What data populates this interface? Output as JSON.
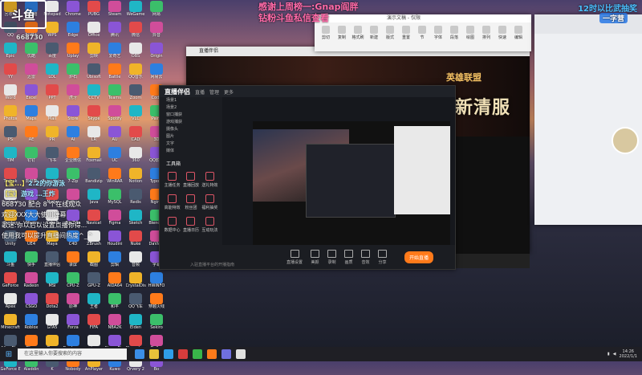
{
  "overlay": {
    "logo": "斗鱼",
    "room_id": "668730",
    "thanks": [
      "感谢上周榜一:Gnap阎胖",
      "钻粉斗鱼私信查看"
    ],
    "danmaku": [
      {
        "user": "【宝...】",
        "text": "2.2的你游泳"
      },
      {
        "user": "【宝】",
        "text": "游戏 …王炸"
      },
      {
        "user": "",
        "text": "668730 配合 8 个在线观众"
      },
      {
        "user": "",
        "text": "欢迎XXX大大使用弹幕"
      },
      {
        "user": "",
        "text": "歌迷:你以后以设置点播你得..."
      },
      {
        "user": "",
        "text": "使用我可以提升直播间热度^_^"
      }
    ]
  },
  "desktop_icons": [
    "回收站",
    "此电脑",
    "Notepad",
    "Chrome",
    "PUBG",
    "Steam",
    "WeGame",
    "网易",
    "QQ",
    "BiliBili",
    "WPS",
    "Edge",
    "Office",
    "腾讯",
    "微信",
    "抖音",
    "Epic",
    "优酷",
    "百度",
    "Uplay",
    "剪映",
    "爱奇艺",
    "OBS",
    "Origin",
    "YY",
    "迅雷",
    "LOL",
    "炉石",
    "Ubisoft",
    "Battle",
    "QQ音乐",
    "网易云",
    "Word",
    "Excel",
    "PPT",
    "虎牙",
    "CCTV",
    "Teams",
    "Zoom",
    "Code",
    "Photos",
    "Maps",
    "Mail",
    "Store",
    "Skype",
    "Spotify",
    "VLC",
    "Paint",
    "PS",
    "AE",
    "PR",
    "AI",
    "LR",
    "AU",
    "CAD",
    "3D",
    "TIM",
    "钉钉",
    "飞书",
    "企业微信",
    "Foxmail",
    "UC",
    "360",
    "QQ影音",
    "Todesk",
    "向日葵",
    "Everything",
    "7-Zip",
    "Bandizip",
    "WinRAR",
    "Notion",
    "Typora",
    "Postman",
    "Git",
    "Node",
    "Python",
    "Java",
    "MySQL",
    "Redis",
    "Nginx",
    "Docker",
    "VMware",
    "Xshell",
    "FileZilla",
    "Navicat",
    "Figma",
    "Sketch",
    "Blender",
    "Unity",
    "UE4",
    "Maya",
    "C4D",
    "ZBrush",
    "Houdini",
    "Nuke",
    "DaVinci",
    "斗鱼",
    "快手",
    "直播伴侣",
    "录屏",
    "截图",
    "剪辑",
    "音频",
    "字幕",
    "GeForce",
    "Radeon",
    "MSI",
    "CPU-Z",
    "GPU-Z",
    "AIDA64",
    "CrystalDisk",
    "HWiNFO",
    "Apex",
    "CSGO",
    "Dota2",
    "原神",
    "王者",
    "和平",
    "QQ飞车",
    "穿越火线",
    "Minecraft",
    "Roblox",
    "GTA5",
    "Forza",
    "FIFA",
    "NBA2K",
    "Elden",
    "Sekiro",
    "Alisa Play",
    "Dhog",
    "Gogo",
    "Dual game",
    "autorun",
    "SteamPics",
    "Chuanlong",
    "Dollar",
    "GeForce Experience",
    "Aladdin",
    "K",
    "Nobody",
    "AnPlayer",
    "Kuwo",
    "Qrvery 2",
    "Bo"
  ],
  "bg_window": {
    "title": "直播伴侣",
    "game_logo": "英雄联盟",
    "promo_title": "传世之战 全新清服"
  },
  "ppt_window": {
    "title": "演示文稿 - 仅限",
    "ribbon": [
      "剪切",
      "复制",
      "格式刷",
      "新建",
      "版式",
      "重置",
      "节",
      "字体",
      "段落",
      "绘图",
      "排列",
      "快速",
      "编辑"
    ]
  },
  "main_window": {
    "app_name": "直播伴侣",
    "tabs": [
      "直播",
      "管理",
      "更多"
    ],
    "sidebar_items": [
      "场景1",
      "场景2",
      "窗口捕获",
      "游戏捕获",
      "摄像头",
      "图片",
      "文字",
      "媒体"
    ],
    "tools_title": "工具箱",
    "tools": [
      "主播任务",
      "直播回放",
      "送礼特效",
      "高能特效",
      "粉丝团",
      "福利抽奖",
      "数据中心",
      "直播日历",
      "互动玩法"
    ],
    "toolbar": [
      "直播设置",
      "美颜",
      "录制",
      "画质",
      "音效",
      "分享"
    ],
    "start_label": "开始直播",
    "footer": "入驻直播平台的开播指南"
  },
  "chat_window": {
    "overlay_title": "12时以比武抽奖",
    "qq_label": "一字营"
  },
  "taskbar": {
    "search_placeholder": "在这里输入你要搜索的内容",
    "time": "14:26",
    "date": "2022/1/1"
  },
  "colors": {
    "accent": "#ff7a1a",
    "thanks": "#ff6aa8",
    "danmaku_user": "#f2e56a"
  }
}
